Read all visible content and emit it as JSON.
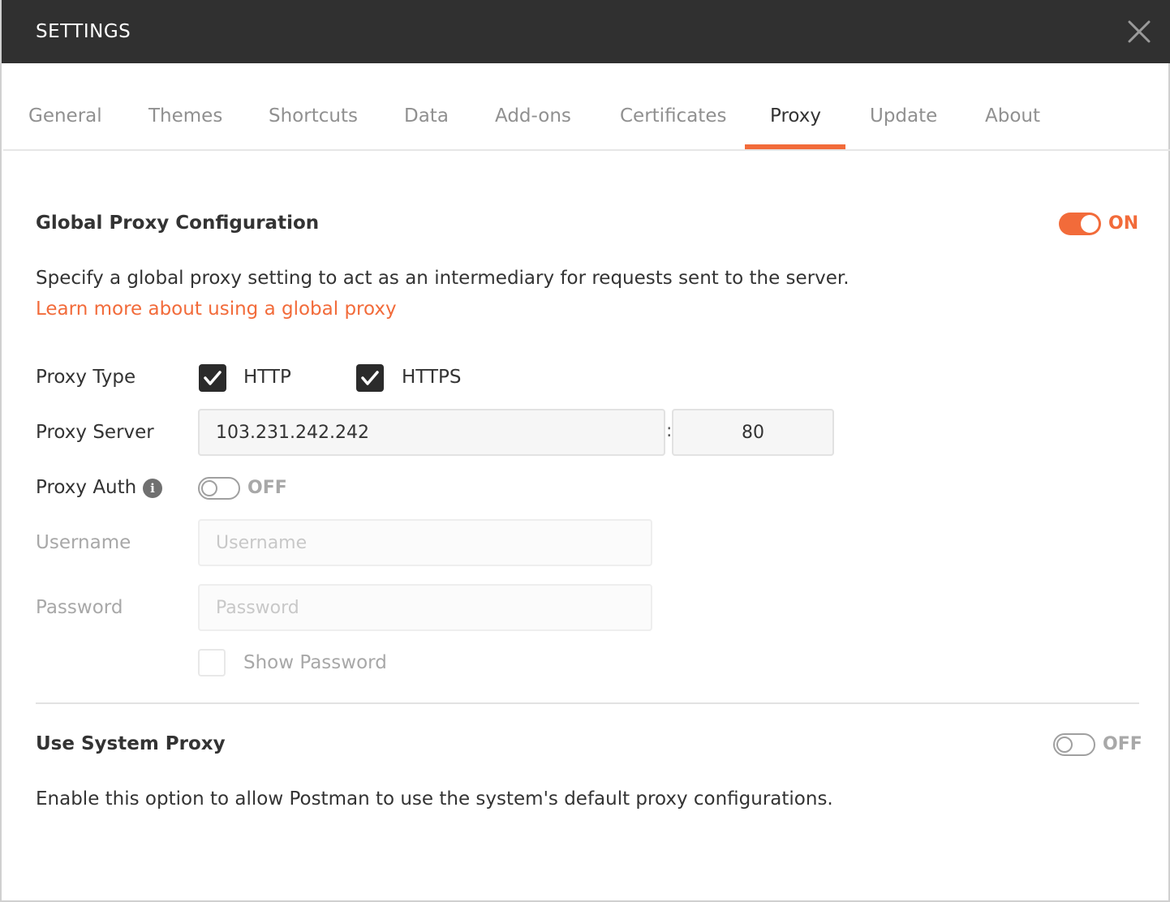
{
  "header": {
    "title": "SETTINGS"
  },
  "tabs": [
    {
      "label": "General"
    },
    {
      "label": "Themes"
    },
    {
      "label": "Shortcuts"
    },
    {
      "label": "Data"
    },
    {
      "label": "Add-ons"
    },
    {
      "label": "Certificates"
    },
    {
      "label": "Proxy",
      "active": true
    },
    {
      "label": "Update"
    },
    {
      "label": "About"
    }
  ],
  "global_proxy": {
    "title": "Global Proxy Configuration",
    "toggle_label": "ON",
    "enabled": true,
    "description": "Specify a global proxy setting to act as an intermediary for requests sent to the server.",
    "learn_more": "Learn more about using a global proxy",
    "proxy_type_label": "Proxy Type",
    "http_label": "HTTP",
    "http_checked": true,
    "https_label": "HTTPS",
    "https_checked": true,
    "proxy_server_label": "Proxy Server",
    "server_value": "103.231.242.242",
    "colon": ":",
    "port_value": "80",
    "proxy_auth_label": "Proxy Auth",
    "info_icon_glyph": "i",
    "auth_toggle_label": "OFF",
    "auth_enabled": false,
    "username_label": "Username",
    "username_placeholder": "Username",
    "password_label": "Password",
    "password_placeholder": "Password",
    "show_password_label": "Show Password",
    "show_password_checked": false
  },
  "system_proxy": {
    "title": "Use System Proxy",
    "toggle_label": "OFF",
    "enabled": false,
    "description": "Enable this option to allow Postman to use the system's default proxy configurations."
  },
  "colors": {
    "accent": "#f26b3a",
    "header_bg": "#303030",
    "checkbox_checked": "#2b2b2b"
  }
}
